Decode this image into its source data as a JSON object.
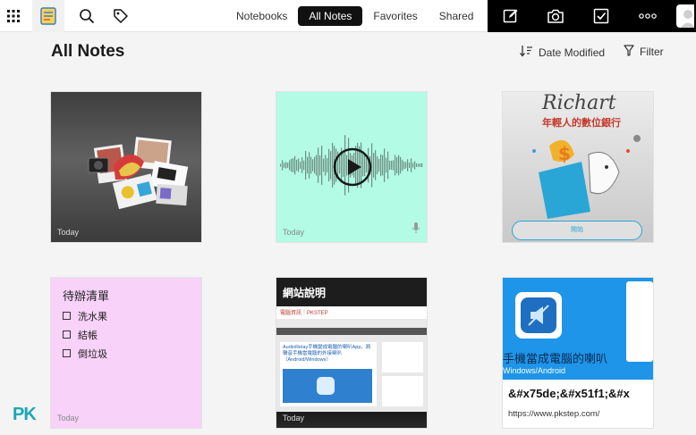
{
  "topbar": {
    "icons": [
      "apps-grid-icon",
      "notes-app-logo",
      "search-icon",
      "tag-icon"
    ],
    "tabs": [
      {
        "label": "Notebooks",
        "active": false
      },
      {
        "label": "All Notes",
        "active": true
      },
      {
        "label": "Favorites",
        "active": false
      },
      {
        "label": "Shared",
        "active": false
      }
    ],
    "actions": [
      "new-note-icon",
      "camera-icon",
      "checklist-icon",
      "more-icon"
    ]
  },
  "main": {
    "title": "All Notes",
    "sort_label": "Date Modified",
    "filter_label": "Filter"
  },
  "notes": [
    {
      "kind": "image",
      "date": "Today"
    },
    {
      "kind": "audio",
      "date": "Today"
    },
    {
      "kind": "image",
      "brand": "Richart",
      "tagline": "年輕人的數位銀行",
      "button": "開始"
    },
    {
      "kind": "checklist",
      "title": "待辦清單",
      "items": [
        "洗水果",
        "結帳",
        "倒垃圾"
      ],
      "date": "Today"
    },
    {
      "kind": "screenshot",
      "title": "網站說明",
      "site": "電腦資訊｜PKSTEP",
      "headline": "AudioRelay手機變成電腦的喇叭App，將聲音手機當電腦的外接喇叭（Android/Windows）",
      "date": "Today"
    },
    {
      "kind": "web-clip",
      "banner_text": "手機當成電腦的喇叭",
      "banner_sub": "Windows/Android",
      "title": "&#x75de;&#x51f1;&#x",
      "url": "https://www.pkstep.com/"
    }
  ],
  "watermark": "PK",
  "colors": {
    "accent_tab": "#111111",
    "audio_card": "#b3fbe5",
    "checklist_card": "#f8d2f9",
    "clip_banner": "#1e95e8"
  }
}
